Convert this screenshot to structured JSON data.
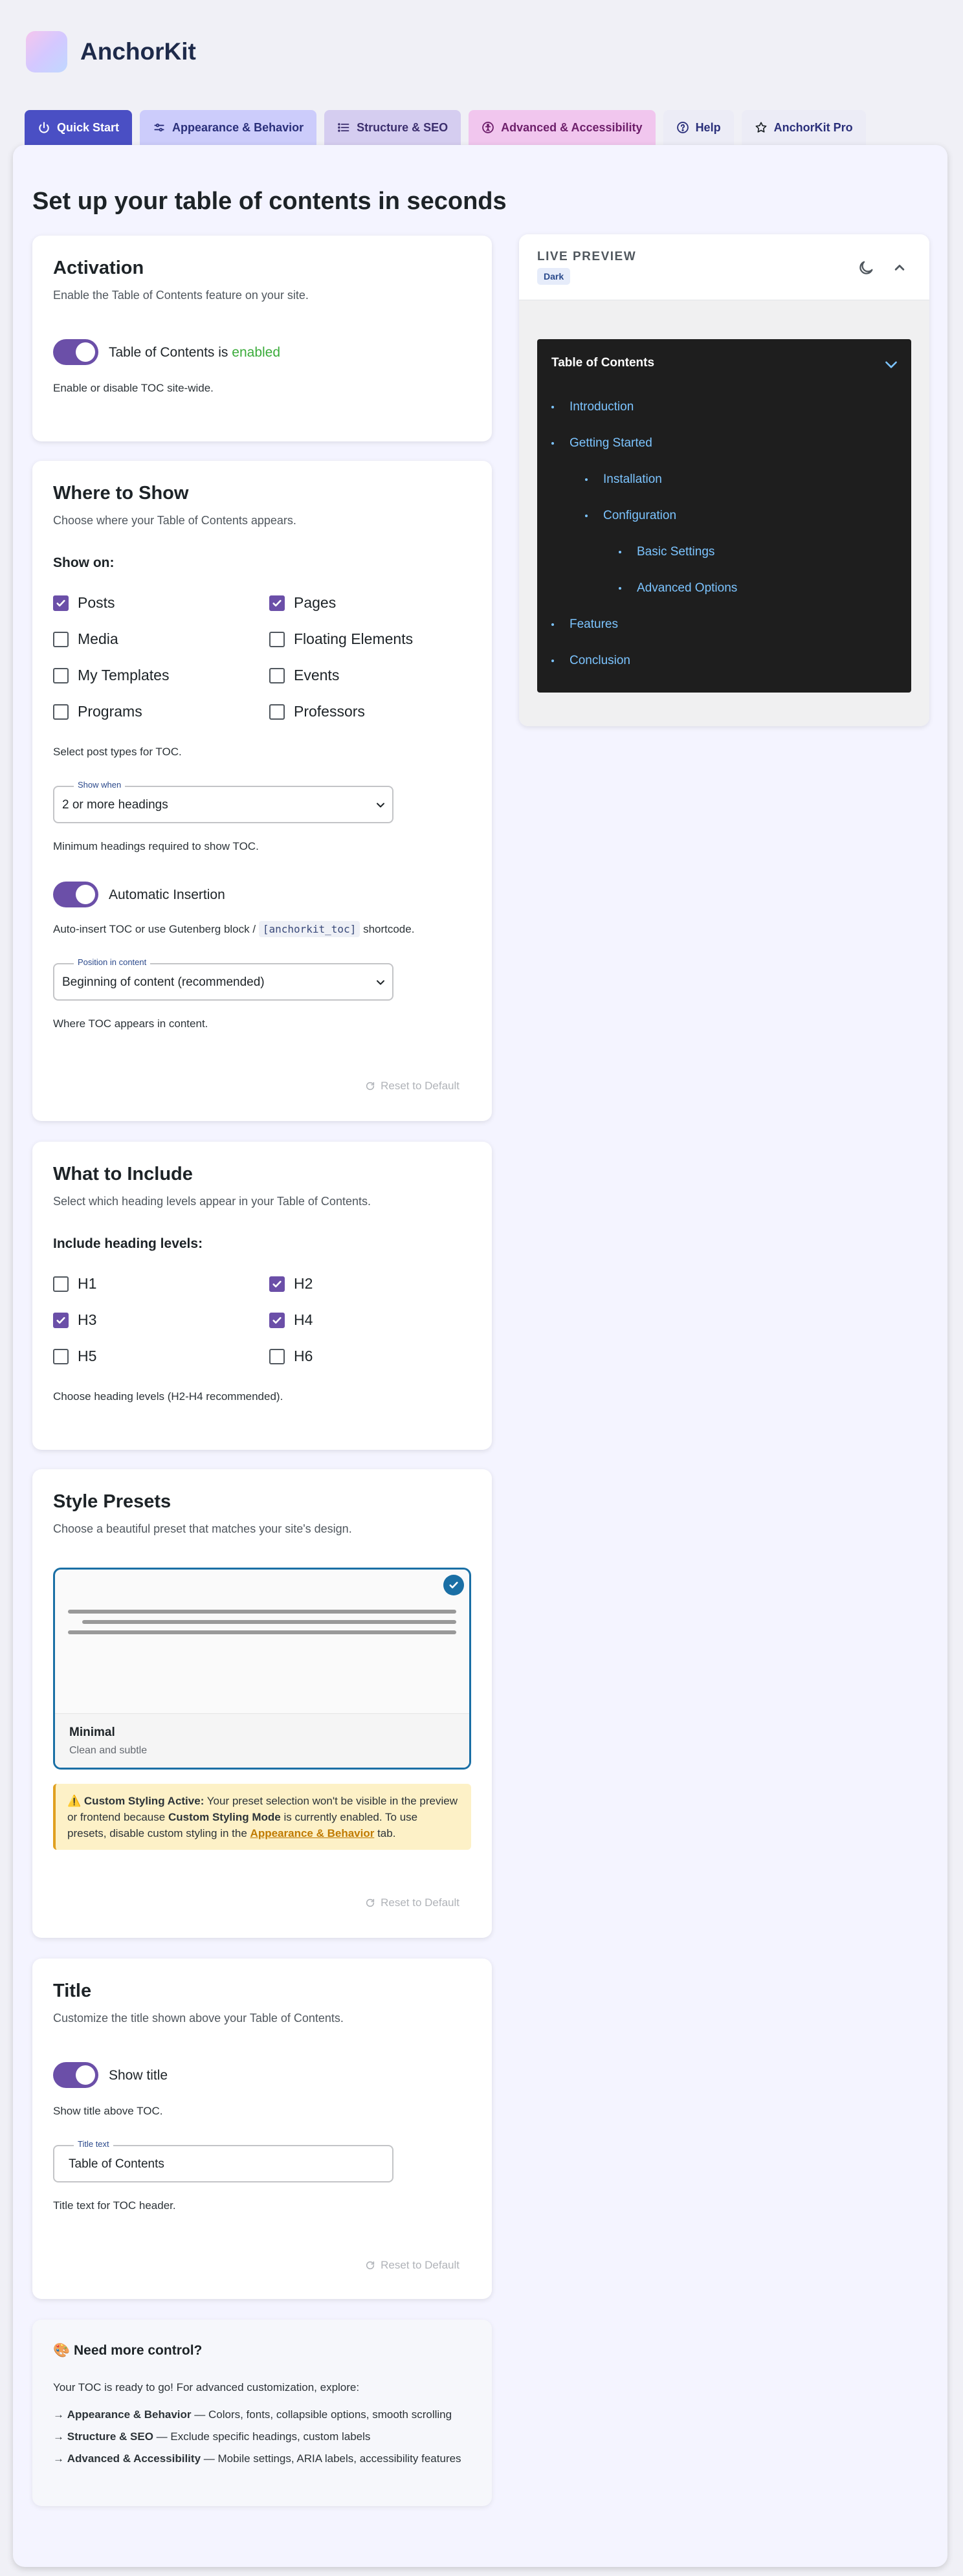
{
  "app": {
    "name": "AnchorKit"
  },
  "tabs": [
    {
      "label": "Quick Start",
      "icon": "power-icon"
    },
    {
      "label": "Appearance & Behavior",
      "icon": "sliders-icon"
    },
    {
      "label": "Structure & SEO",
      "icon": "list-icon"
    },
    {
      "label": "Advanced & Accessibility",
      "icon": "accessibility-icon"
    },
    {
      "label": "Help",
      "icon": "help-circle-icon"
    },
    {
      "label": "AnchorKit Pro",
      "icon": "star-icon"
    }
  ],
  "page": {
    "title": "Set up your table of contents in seconds"
  },
  "activation": {
    "title": "Activation",
    "desc": "Enable the Table of Contents feature on your site.",
    "toggle_label_prefix": "Table of Contents is",
    "toggle_state": "enabled",
    "help": "Enable or disable TOC site-wide."
  },
  "where": {
    "title": "Where to Show",
    "desc": "Choose where your Table of Contents appears.",
    "show_on": "Show on:",
    "post_types": [
      {
        "label": "Posts",
        "checked": true
      },
      {
        "label": "Pages",
        "checked": true
      },
      {
        "label": "Media",
        "checked": false
      },
      {
        "label": "Floating Elements",
        "checked": false
      },
      {
        "label": "My Templates",
        "checked": false
      },
      {
        "label": "Events",
        "checked": false
      },
      {
        "label": "Programs",
        "checked": false
      },
      {
        "label": "Professors",
        "checked": false
      }
    ],
    "post_types_help": "Select post types for TOC.",
    "show_when_label": "Show when",
    "show_when_value": "2 or more headings",
    "show_when_help": "Minimum headings required to show TOC.",
    "auto_label": "Automatic Insertion",
    "auto_help_prefix": "Auto-insert TOC or use Gutenberg block /",
    "auto_help_code": "[anchorkit_toc]",
    "auto_help_suffix": "shortcode.",
    "position_label": "Position in content",
    "position_value": "Beginning of content (recommended)",
    "position_help": "Where TOC appears in content.",
    "reset": "Reset to Default"
  },
  "include": {
    "title": "What to Include",
    "desc": "Select which heading levels appear in your Table of Contents.",
    "levels_label": "Include heading levels:",
    "levels": [
      {
        "label": "H1",
        "checked": false
      },
      {
        "label": "H2",
        "checked": true
      },
      {
        "label": "H3",
        "checked": true
      },
      {
        "label": "H4",
        "checked": true
      },
      {
        "label": "H5",
        "checked": false
      },
      {
        "label": "H6",
        "checked": false
      }
    ],
    "help": "Choose heading levels (H2-H4 recommended)."
  },
  "presets": {
    "title": "Style Presets",
    "desc": "Choose a beautiful preset that matches your site's design.",
    "selected_name": "Minimal",
    "selected_sub": "Clean and subtle",
    "notice_icon": "⚠️",
    "notice_strong": "Custom Styling Active:",
    "notice_text1": "Your preset selection won't be visible in the preview or frontend because",
    "notice_strong2": "Custom Styling Mode",
    "notice_text2": "is currently enabled. To use presets, disable custom styling in the",
    "notice_link": "Appearance & Behavior",
    "notice_text3": "tab.",
    "reset": "Reset to Default"
  },
  "title_card": {
    "title": "Title",
    "desc": "Customize the title shown above your Table of Contents.",
    "toggle_label": "Show title",
    "toggle_help": "Show title above TOC.",
    "input_label": "Title text",
    "input_value": "Table of Contents",
    "input_help": "Title text for TOC header.",
    "reset": "Reset to Default"
  },
  "more": {
    "icon": "🎨",
    "title": "Need more control?",
    "intro": "Your TOC is ready to go! For advanced customization, explore:",
    "items": [
      {
        "arrow": "→",
        "strong": "Appearance & Behavior",
        "text": "— Colors, fonts, collapsible options, smooth scrolling"
      },
      {
        "arrow": "→",
        "strong": "Structure & SEO",
        "text": "— Exclude specific headings, custom labels"
      },
      {
        "arrow": "→",
        "strong": "Advanced & Accessibility",
        "text": "— Mobile settings, ARIA labels, accessibility features"
      }
    ]
  },
  "preview": {
    "label": "LIVE PREVIEW",
    "badge": "Dark",
    "toc_title": "Table of Contents",
    "items": [
      {
        "label": "Introduction",
        "level": 1
      },
      {
        "label": "Getting Started",
        "level": 1
      },
      {
        "label": "Installation",
        "level": 2
      },
      {
        "label": "Configuration",
        "level": 2
      },
      {
        "label": "Basic Settings",
        "level": 3
      },
      {
        "label": "Advanced Options",
        "level": 3
      },
      {
        "label": "Features",
        "level": 1
      },
      {
        "label": "Conclusion",
        "level": 1
      }
    ]
  },
  "colors": {
    "accent": "#6b4fa8",
    "primary_tab": "#4a4fc4",
    "preset_border": "#1a6fa5",
    "toc_bg": "#1e1e1e",
    "toc_link": "#7cc4ff",
    "enabled_green": "#3aab3a"
  }
}
